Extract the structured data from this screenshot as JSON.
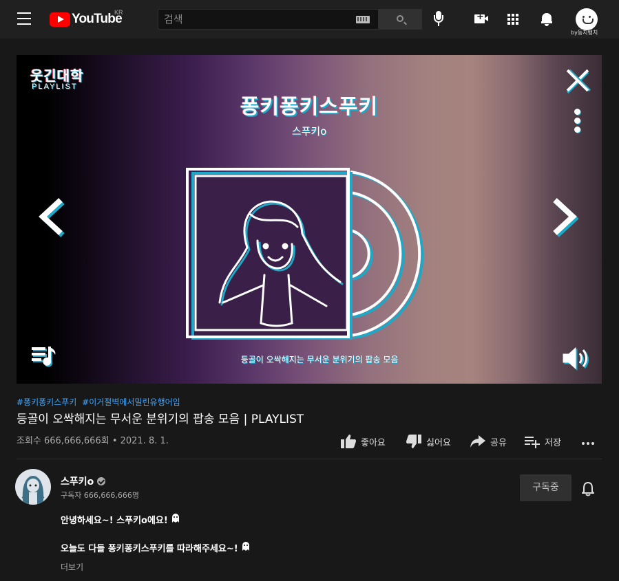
{
  "header": {
    "logo_text": "YouTube",
    "logo_country": "KR",
    "search_placeholder": "검색",
    "account_caption": "by동치뱅치"
  },
  "player": {
    "channel_logo": "웃긴대학",
    "channel_logo_sub": "PLAYLIST",
    "playlist_title": "퐁키퐁키스푸키",
    "playlist_artist": "스푸키o",
    "caption": "등골이 오싹해지는 무서운 분위기의 팝송 모음"
  },
  "video": {
    "hashtags": [
      "#퐁키퐁키스푸키",
      "#이거절벽에서밀린유행어임"
    ],
    "title": "등골이 오싹해지는 무서운 분위기의 팝송 모음 | PLAYLIST",
    "views": "조회수 666,666,666회",
    "date": "2021. 8. 1."
  },
  "actions": {
    "like": "좋아요",
    "dislike": "싫어요",
    "share": "공유",
    "save": "저장"
  },
  "channel": {
    "name": "스푸키o",
    "subscribers": "구독자 666,666,666명",
    "subscribe_label": "구독중"
  },
  "description": {
    "line1": "안녕하세요~! 스푸키o에요!",
    "line2": "오늘도 다들 퐁키퐁키스푸키를 따라해주세요~!",
    "more": "더보기"
  },
  "colors": {
    "background": "#181818",
    "header": "#202020",
    "brand_red": "#ff0000",
    "hashtag_blue": "#3ea6ff",
    "accent_cyan": "#1da8c8"
  }
}
